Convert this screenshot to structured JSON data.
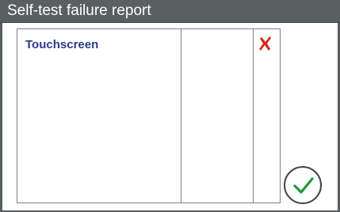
{
  "dialog": {
    "title": "Self-test failure report"
  },
  "report": {
    "rows": [
      {
        "label": "Touchscreen",
        "status_icon": "fail-x-icon",
        "status_color": "#d8261c"
      }
    ]
  },
  "confirm": {
    "icon": "checkmark-icon",
    "color": "#1f9a3a"
  }
}
